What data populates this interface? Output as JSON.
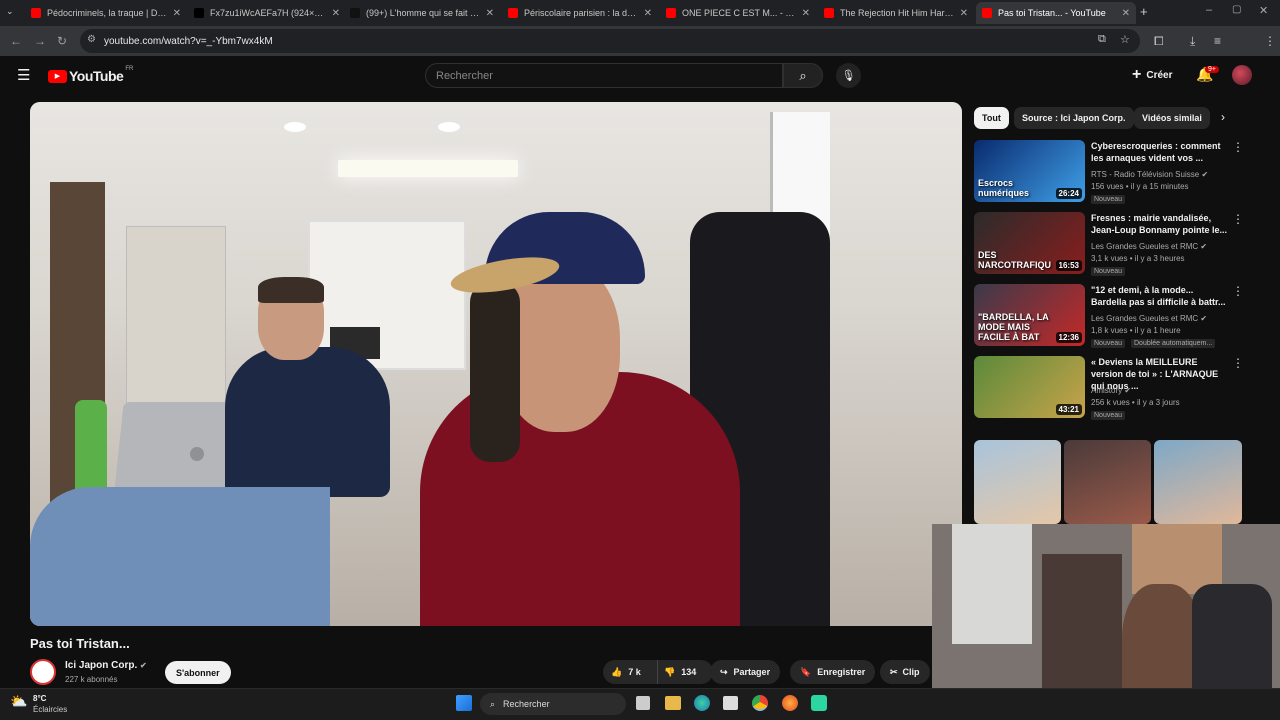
{
  "tabs": [
    {
      "title": "Pédocriminels, la traque | Docu",
      "color": "#ff0000"
    },
    {
      "title": "Fx7zu1iWcAEFa7H (924×790)",
      "color": "#000000"
    },
    {
      "title": "(99+) L'homme qui se fait agres",
      "color": "#111111"
    },
    {
      "title": "Périscolaire parisien : la descen",
      "color": "#ff0000"
    },
    {
      "title": "ONE PIECE C EST M... - LA COM",
      "color": "#ff0000"
    },
    {
      "title": "The Rejection Hit Him Hard 😔",
      "color": "#ff0000"
    },
    {
      "title": "Pas toi Tristan... - YouTube",
      "color": "#ff0000"
    }
  ],
  "url": "youtube.com/watch?v=_-Ybm7wx4kM",
  "yt": {
    "logo": "YouTube",
    "region": "FR",
    "search_placeholder": "Rechercher",
    "create_label": "Créer",
    "notif_count": "9+"
  },
  "chips": [
    "Tout",
    "Source : Ici Japon Corp.",
    "Vidéos similai"
  ],
  "recommendations": [
    {
      "title": "Cyberescroqueries : comment les arnaques vident vos ...",
      "channel": "RTS - Radio Télévision Suisse",
      "stats": "156 vues • il y a 15 minutes",
      "badge": "Nouveau",
      "duration": "26:24",
      "thumb_text": "Escrocs numériques",
      "colors": [
        "#0a2a6e",
        "#3fa0e8"
      ]
    },
    {
      "title": "Fresnes : mairie vandalisée, Jean-Loup Bonnamy pointe le...",
      "channel": "Les Grandes Gueules et RMC",
      "stats": "3,1 k vues • il y a 3 heures",
      "badge": "Nouveau",
      "duration": "16:53",
      "thumb_text": "DES NARCOTRAFIQU",
      "colors": [
        "#2b2b2b",
        "#8a1d1d"
      ]
    },
    {
      "title": "\"12 et demi, à la mode... Bardella pas si difficile à battr...",
      "channel": "Les Grandes Gueules et RMC",
      "stats": "1,8 k vues • il y a 1 heure",
      "badge": "Nouveau",
      "badge2": "Doublée automatiquem...",
      "duration": "12:36",
      "thumb_text": "\"BARDELLA, LA MODE MAIS FACILE À BAT",
      "colors": [
        "#3a3a4a",
        "#c52828"
      ]
    },
    {
      "title": "« Deviens la MEILLEURE version de toi » : L'ARNAQUE qui nous ...",
      "channel": "Amistory",
      "stats": "256 k vues • il y a 3 jours",
      "badge": "Nouveau",
      "duration": "43:21",
      "thumb_text": "",
      "colors": [
        "#5a8a3a",
        "#c9a34a"
      ]
    }
  ],
  "video": {
    "title": "Pas toi Tristan...",
    "channel": "Ici Japon Corp.",
    "subs": "227 k abonnés",
    "subscribe": "S'abonner",
    "likes": "7 k",
    "dislikes": "134",
    "share": "Partager",
    "save": "Enregistrer",
    "clip": "Clip"
  },
  "taskbar": {
    "temp": "8°C",
    "weather": "Éclaircies",
    "search": "Rechercher"
  }
}
